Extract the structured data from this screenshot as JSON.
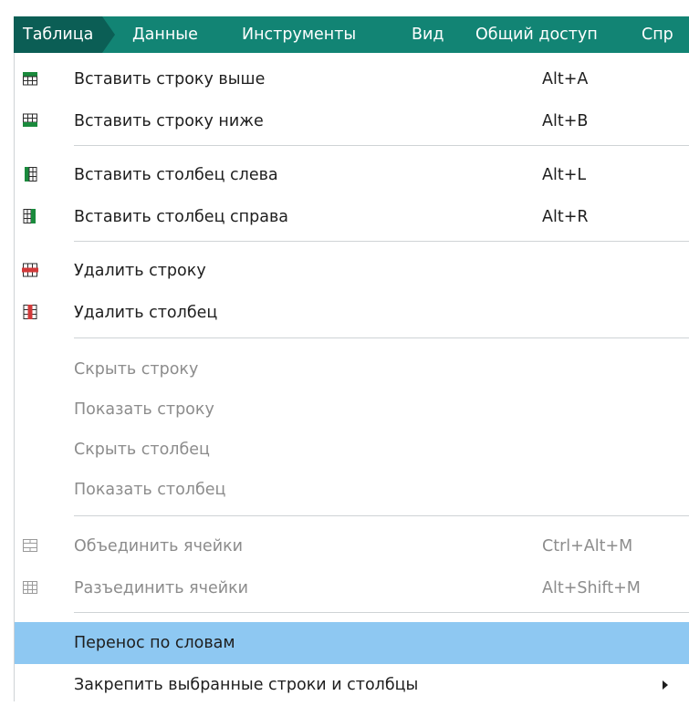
{
  "menubar": {
    "items": [
      {
        "label": "Таблица",
        "active": true
      },
      {
        "label": "Данные"
      },
      {
        "label": "Инструменты"
      },
      {
        "label": "Вид"
      },
      {
        "label": "Общий доступ"
      },
      {
        "label": "Спр"
      }
    ]
  },
  "menu": {
    "insert_row_above": {
      "label": "Вставить строку выше",
      "shortcut": "Alt+A",
      "icon": "insert-row-above-icon"
    },
    "insert_row_below": {
      "label": "Вставить строку ниже",
      "shortcut": "Alt+B",
      "icon": "insert-row-below-icon"
    },
    "insert_col_left": {
      "label": "Вставить столбец слева",
      "shortcut": "Alt+L",
      "icon": "insert-column-left-icon"
    },
    "insert_col_right": {
      "label": "Вставить столбец справа",
      "shortcut": "Alt+R",
      "icon": "insert-column-right-icon"
    },
    "delete_row": {
      "label": "Удалить строку",
      "icon": "delete-row-icon"
    },
    "delete_col": {
      "label": "Удалить столбец",
      "icon": "delete-column-icon"
    },
    "hide_row": {
      "label": "Скрыть строку"
    },
    "show_row": {
      "label": "Показать строку"
    },
    "hide_col": {
      "label": "Скрыть столбец"
    },
    "show_col": {
      "label": "Показать столбец"
    },
    "merge_cells": {
      "label": "Объединить ячейки",
      "shortcut": "Ctrl+Alt+M",
      "icon": "merge-cells-icon"
    },
    "split_cells": {
      "label": "Разъединить ячейки",
      "shortcut": "Alt+Shift+M",
      "icon": "split-cells-icon"
    },
    "word_wrap": {
      "label": "Перенос по словам"
    },
    "freeze": {
      "label": "Закрепить выбранные строки и столбцы",
      "icon": "submenu-arrow-icon"
    }
  },
  "colors": {
    "menubar_bg": "#128474",
    "menubar_active": "#0b5e55",
    "highlight": "#8ec8f2",
    "icon_green": "#1a8a3c",
    "icon_red": "#d23a3a",
    "disabled_text": "#8c8c8c"
  }
}
